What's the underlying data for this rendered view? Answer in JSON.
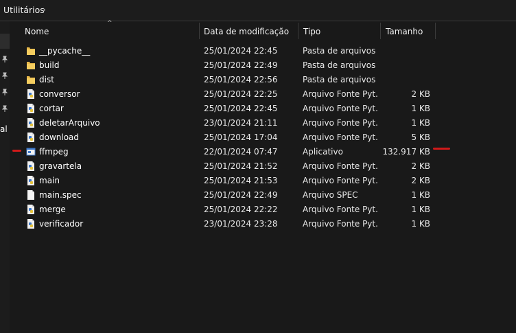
{
  "address_bar": {
    "path": "Utilitários",
    "chevron": "›"
  },
  "nav": {
    "partial_label": "al"
  },
  "columns": {
    "name": "Nome",
    "date": "Data de modificação",
    "type": "Tipo",
    "size": "Tamanho"
  },
  "files": [
    {
      "name": "__pycache__",
      "date": "25/01/2024 22:45",
      "type": "Pasta de arquivos",
      "size": "",
      "icon": "folder-icon"
    },
    {
      "name": "build",
      "date": "25/01/2024 22:49",
      "type": "Pasta de arquivos",
      "size": "",
      "icon": "folder-icon"
    },
    {
      "name": "dist",
      "date": "25/01/2024 22:56",
      "type": "Pasta de arquivos",
      "size": "",
      "icon": "folder-icon"
    },
    {
      "name": "conversor",
      "date": "25/01/2024 22:25",
      "type": "Arquivo Fonte Pyt...",
      "size": "2 KB",
      "icon": "python-file-icon"
    },
    {
      "name": "cortar",
      "date": "25/01/2024 22:45",
      "type": "Arquivo Fonte Pyt...",
      "size": "1 KB",
      "icon": "python-file-icon"
    },
    {
      "name": "deletarArquivo",
      "date": "23/01/2024 21:11",
      "type": "Arquivo Fonte Pyt...",
      "size": "1 KB",
      "icon": "python-file-icon"
    },
    {
      "name": "download",
      "date": "25/01/2024 17:04",
      "type": "Arquivo Fonte Pyt...",
      "size": "5 KB",
      "icon": "python-file-icon"
    },
    {
      "name": "ffmpeg",
      "date": "22/01/2024 07:47",
      "type": "Aplicativo",
      "size": "132.917 KB",
      "icon": "application-icon"
    },
    {
      "name": "gravartela",
      "date": "25/01/2024 21:52",
      "type": "Arquivo Fonte Pyt...",
      "size": "2 KB",
      "icon": "python-file-icon"
    },
    {
      "name": "main",
      "date": "25/01/2024 21:53",
      "type": "Arquivo Fonte Pyt...",
      "size": "2 KB",
      "icon": "python-file-icon"
    },
    {
      "name": "main.spec",
      "date": "25/01/2024 22:49",
      "type": "Arquivo SPEC",
      "size": "1 KB",
      "icon": "document-icon"
    },
    {
      "name": "merge",
      "date": "25/01/2024 22:22",
      "type": "Arquivo Fonte Pyt...",
      "size": "1 KB",
      "icon": "python-file-icon"
    },
    {
      "name": "verificador",
      "date": "23/01/2024 23:28",
      "type": "Arquivo Fonte Pyt...",
      "size": "1 KB",
      "icon": "python-file-icon"
    }
  ],
  "colors": {
    "background": "#191919",
    "annotation_mark": "#d11a1a",
    "folder": "#e8b84a",
    "python_blue": "#4a8ad6"
  }
}
